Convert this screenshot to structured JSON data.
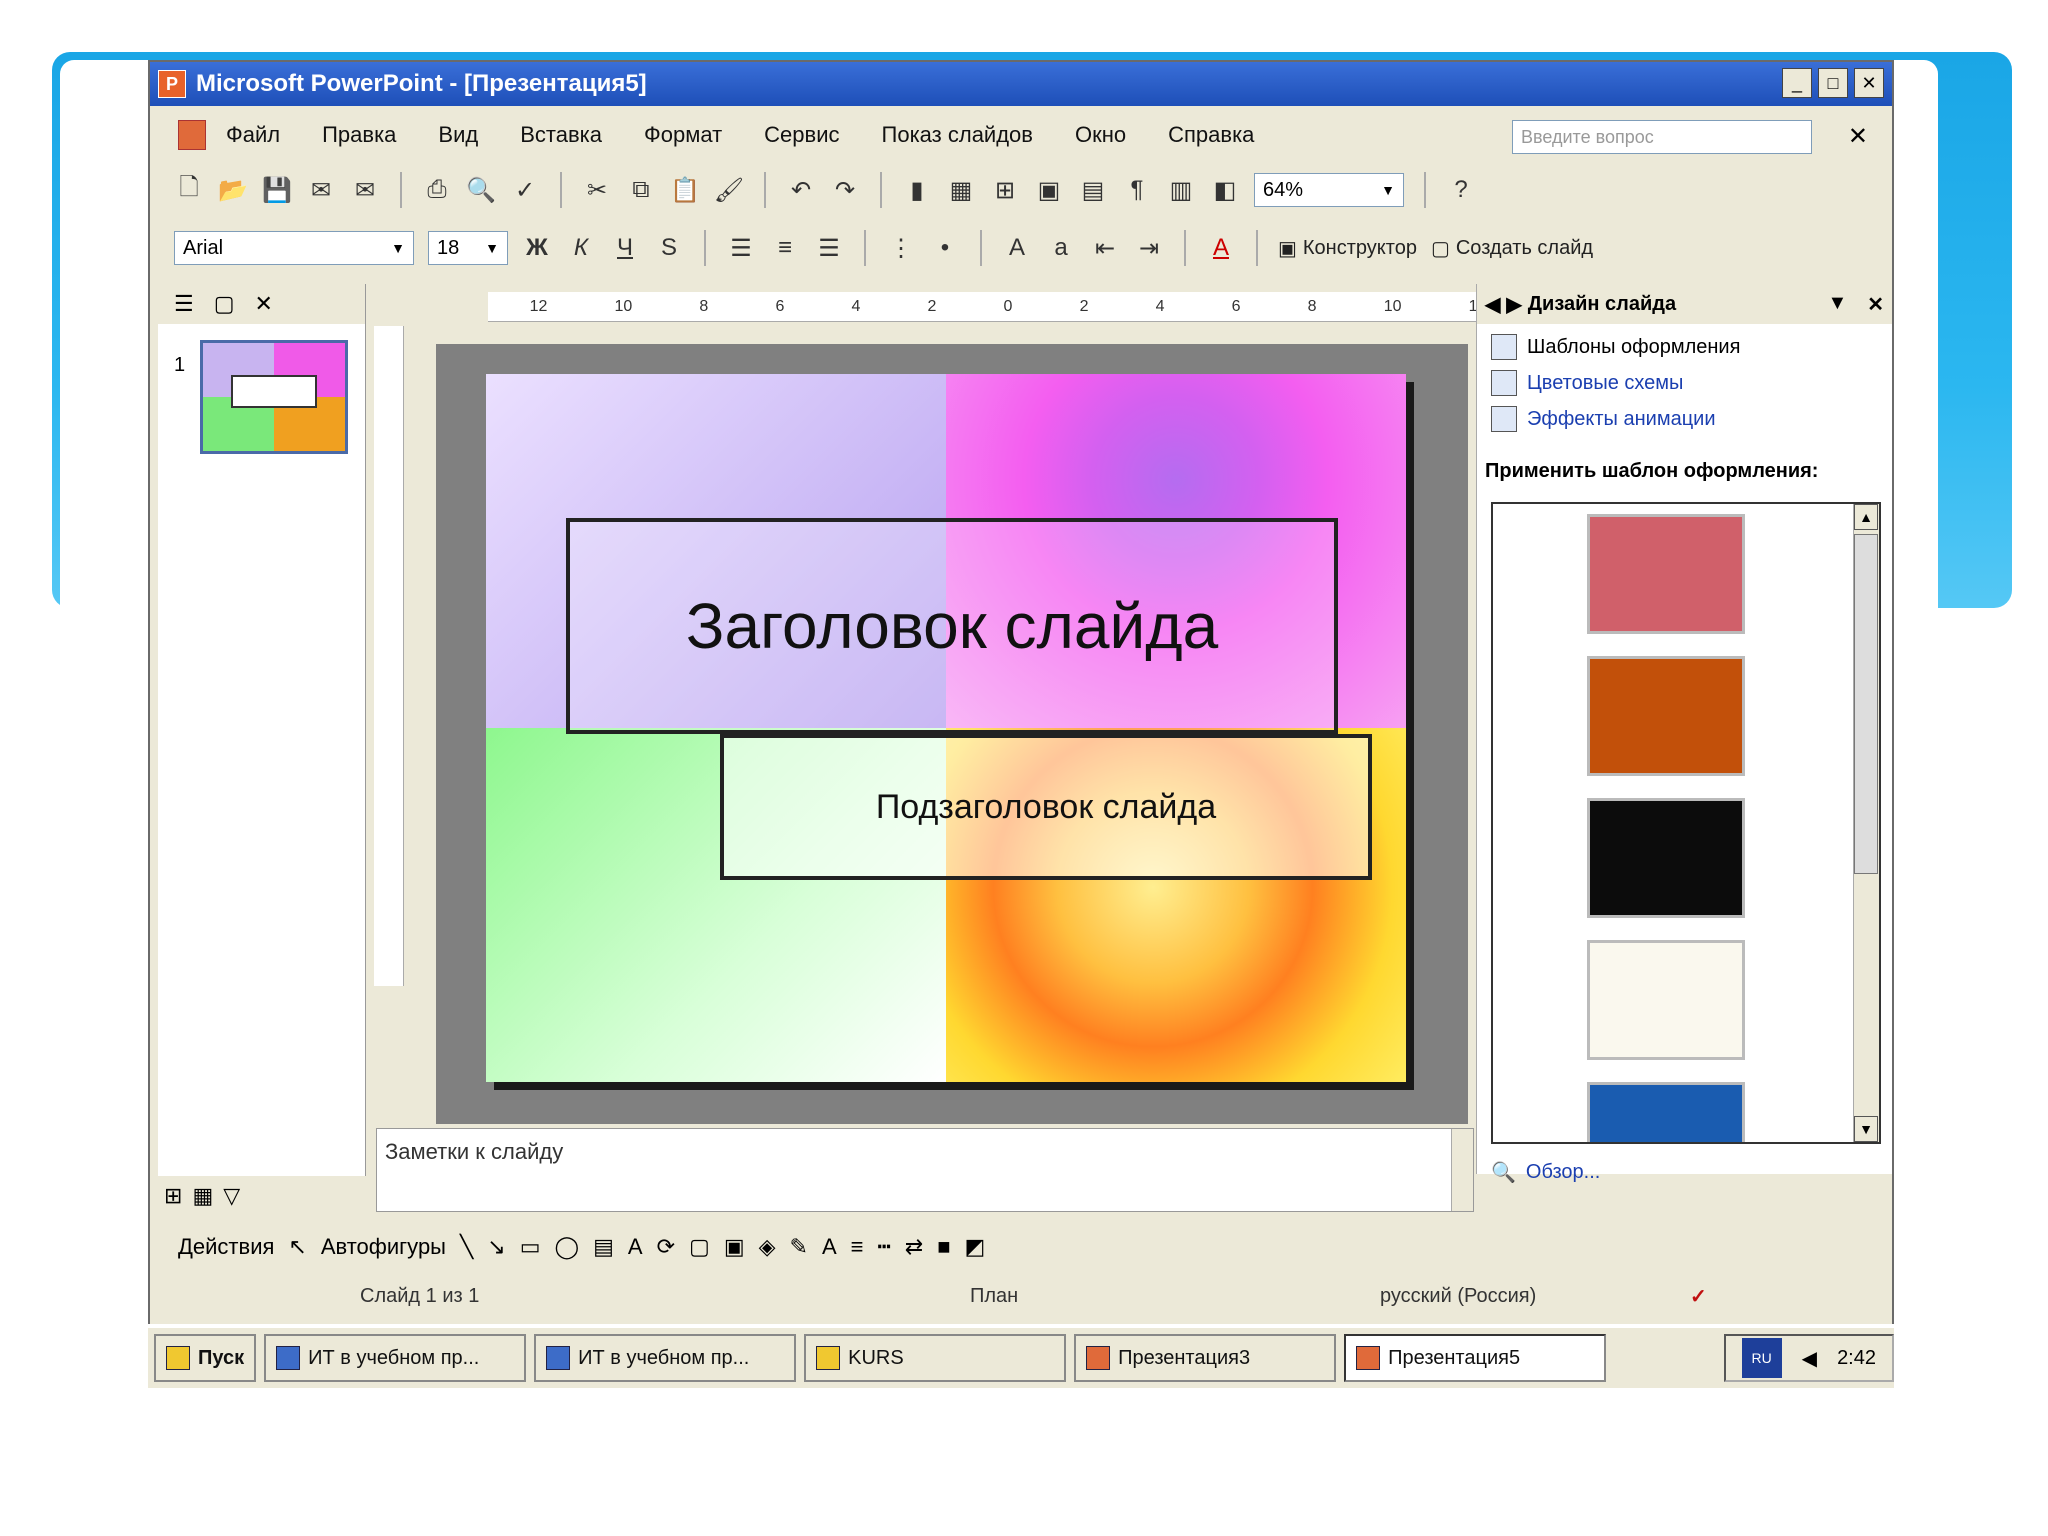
{
  "window": {
    "title": "Microsoft PowerPoint - [Презентация5]"
  },
  "menu": {
    "items": [
      "Файл",
      "Правка",
      "Вид",
      "Вставка",
      "Формат",
      "Сервис",
      "Показ слайдов",
      "Окно",
      "Справка"
    ],
    "ask_placeholder": "Введите вопрос"
  },
  "toolbar1": {
    "zoom": "64%"
  },
  "toolbar2": {
    "font": "Arial",
    "size": "18",
    "designer": "Конструктор",
    "new_slide": "Создать слайд"
  },
  "left_pane": {
    "slide_number": "1"
  },
  "slide": {
    "title": "Заголовок слайда",
    "subtitle": "Подзаголовок слайда"
  },
  "notes": {
    "placeholder": "Заметки к слайду"
  },
  "task_pane": {
    "title": "Дизайн слайда",
    "links": [
      "Шаблоны оформления",
      "Цветовые схемы",
      "Эффекты анимации"
    ],
    "apply_label": "Применить шаблон оформления:",
    "templates": [
      {
        "color": "#d0606a"
      },
      {
        "color": "#c2500a"
      },
      {
        "color": "#0c0c0c"
      },
      {
        "color": "#faf8ee"
      },
      {
        "color": "#1a5cb0"
      }
    ],
    "browse": "Обзор..."
  },
  "drawing": {
    "actions": "Действия",
    "autoshapes": "Автофигуры"
  },
  "status": {
    "slide": "Слайд 1 из 1",
    "design": "План",
    "language": "русский (Россия)"
  },
  "taskbar": {
    "start": "Пуск",
    "items": [
      "ИТ в учебном пр...",
      "ИТ в учебном пр...",
      "KURS",
      "Презентация3",
      "Презентация5"
    ],
    "clock": "2:42",
    "lang": "RU"
  }
}
